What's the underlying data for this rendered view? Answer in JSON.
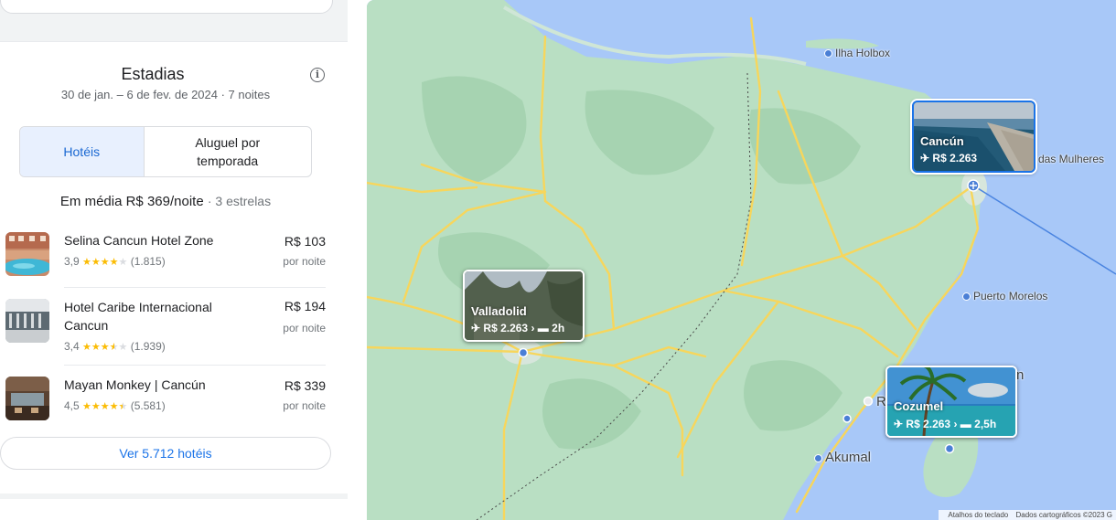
{
  "stays": {
    "title": "Estadias",
    "dates": "30 de jan. – 6 de fev. de 2024 · 7 noites",
    "tabs": [
      {
        "label": "Hotéis",
        "selected": true
      },
      {
        "label": "Aluguel por temporada",
        "selected": false
      }
    ],
    "average": "Em média R$ 369/noite",
    "stars_note": "· 3 estrelas",
    "hotels": [
      {
        "name": "Selina Cancun Hotel Zone",
        "rating": "3,9",
        "stars": 4,
        "reviews": "(1.815)",
        "price": "R$ 103",
        "per": "por noite"
      },
      {
        "name": "Hotel Caribe Internacional Cancun",
        "rating": "3,4",
        "stars": 3.5,
        "reviews": "(1.939)",
        "price": "R$ 194",
        "per": "por noite"
      },
      {
        "name": "Mayan Monkey | Cancún",
        "rating": "4,5",
        "stars": 4.5,
        "reviews": "(5.581)",
        "price": "R$ 339",
        "per": "por noite"
      }
    ],
    "more_button": "Ver 5.712 hotéis"
  },
  "map": {
    "places": {
      "holbox": "Ilha Holbox",
      "mujeres": "das Mulheres",
      "morelos": "Puerto Morelos",
      "akumal": "Akumal",
      "r_partial": "R",
      "n_partial": "n"
    },
    "destinations": [
      {
        "name": "Cancún",
        "flight": "R$ 2.263",
        "drive": "",
        "selected": true
      },
      {
        "name": "Valladolid",
        "flight": "R$ 2.263",
        "drive": "2h",
        "selected": false
      },
      {
        "name": "Cozumel",
        "flight": "R$ 2.263",
        "drive": "2,5h",
        "selected": false
      }
    ],
    "attribution": {
      "shortcuts": "Atalhos do teclado",
      "data": "Dados cartográficos ©2023 G"
    },
    "colors": {
      "land": "#b9dfc3",
      "water": "#a8c8f8",
      "road": "#f7d65c",
      "accent": "#1a73e8"
    }
  }
}
